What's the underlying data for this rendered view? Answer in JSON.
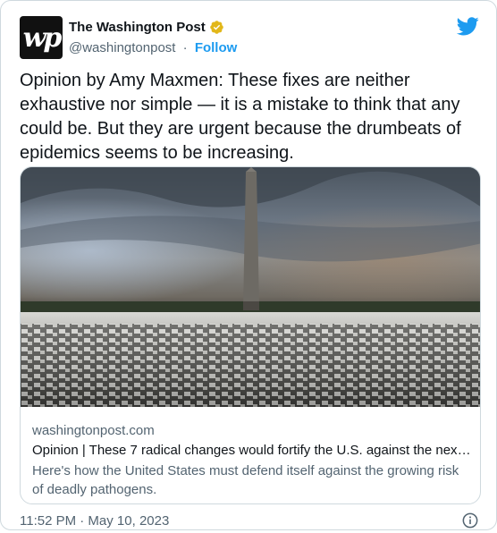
{
  "author": {
    "name": "The Washington Post",
    "handle": "@washingtonpost",
    "separator": "·",
    "follow_label": "Follow",
    "logo_text": "wp"
  },
  "tweet": {
    "text": "Opinion by Amy Maxmen: These fixes are neither exhaustive nor simple — it is a mistake to think that any could be. But they are urgent because the drumbeats of epidemics seems to be increasing."
  },
  "card": {
    "domain": "washingtonpost.com",
    "title": "Opinion | These 7 radical changes would fortify the U.S. against the next ...",
    "description": "Here's how the United States must defend itself against the growing risk of deadly pathogens."
  },
  "footer": {
    "timestamp": "11:52 PM · May 10, 2023"
  },
  "colors": {
    "accent": "#1d9bf0",
    "verified_gold": "#e2b719",
    "secondary_text": "#536471"
  },
  "icons": {
    "brand": "twitter-bird-icon",
    "verified": "verified-badge-icon",
    "info": "info-icon"
  }
}
